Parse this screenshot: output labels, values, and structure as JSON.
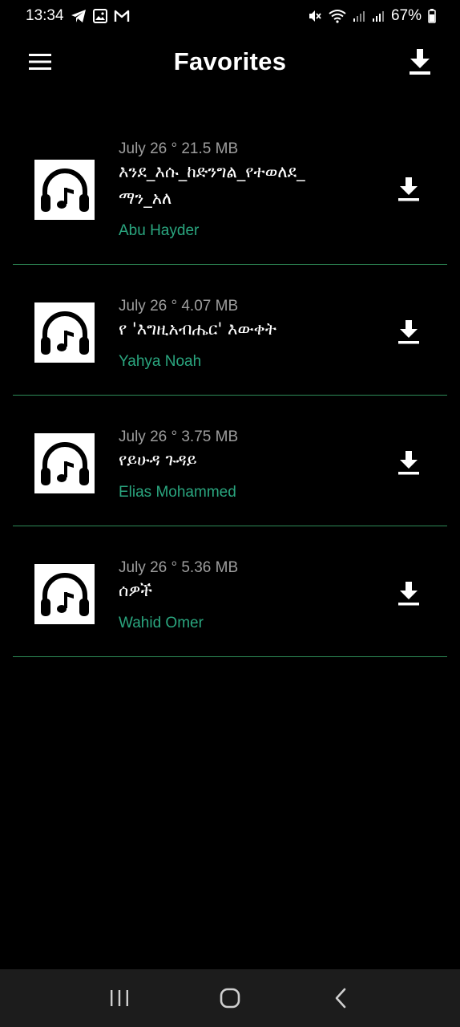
{
  "status_bar": {
    "time": "13:34",
    "left_icons": [
      "telegram-icon",
      "gallery-icon",
      "gmail-icon"
    ],
    "right_icons": [
      "mute-icon",
      "wifi-icon",
      "signal-icon",
      "signal-icon"
    ],
    "battery": "67%"
  },
  "app_bar": {
    "title": "Favorites",
    "menu_icon": "hamburger-menu-icon",
    "action_icon": "download-icon"
  },
  "items": [
    {
      "meta": "July 26 ° 21.5 MB",
      "title": "እንደ_እሱ_ከድንግል_የተወለደ_ ማን_አለ",
      "artist": "Abu Hayder",
      "thumb_icon": "headphones-music-icon",
      "action_icon": "download-icon"
    },
    {
      "meta": "July 26 ° 4.07 MB",
      "title": "የ 'እግዚአብሔር' እውቀት",
      "artist": "Yahya Noah",
      "thumb_icon": "headphones-music-icon",
      "action_icon": "download-icon"
    },
    {
      "meta": "July 26 ° 3.75 MB",
      "title": "የይሁዳ ጉዳይ",
      "artist": "Elias Mohammed",
      "thumb_icon": "headphones-music-icon",
      "action_icon": "download-icon"
    },
    {
      "meta": "July 26 ° 5.36 MB",
      "title": "ሰዎች",
      "artist": "Wahid Omer",
      "thumb_icon": "headphones-music-icon",
      "action_icon": "download-icon"
    }
  ],
  "colors": {
    "background": "#000000",
    "accent_artist": "#2aa67f",
    "divider": "#2e8b57",
    "meta_text": "#9e9e9e",
    "nav_bar": "#1c1c1c"
  },
  "nav_bar": {
    "buttons": [
      "recent-apps-icon",
      "home-icon",
      "back-icon"
    ]
  }
}
